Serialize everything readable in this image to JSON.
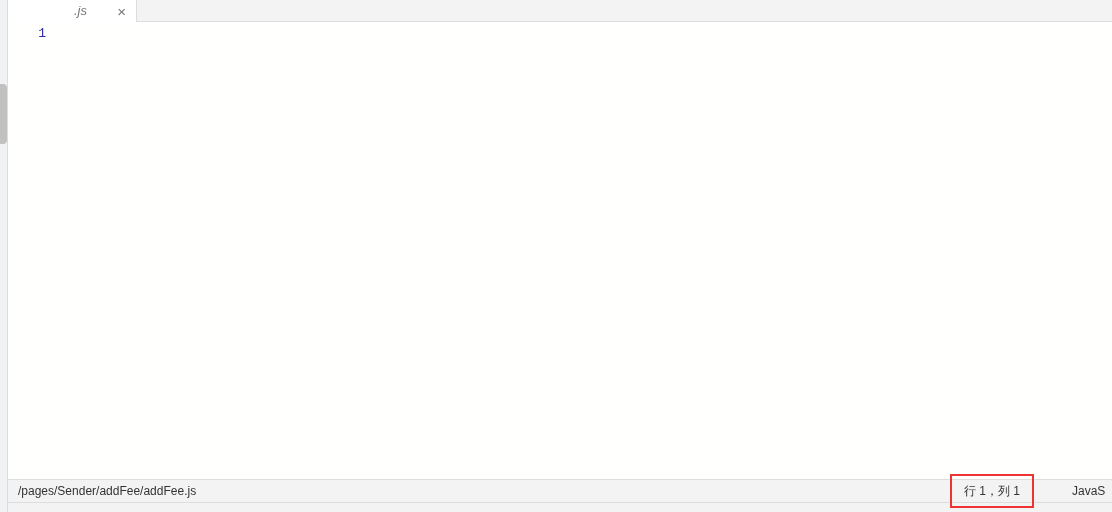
{
  "tab": {
    "title": ".js",
    "close": "×",
    "selected": true
  },
  "editor": {
    "line_numbers": [
      "1"
    ]
  },
  "status_bar": {
    "path": "/pages/Sender/addFee/addFee.js",
    "position": "行 1，列 1",
    "language": "JavaS",
    "position_highlighted": true
  }
}
